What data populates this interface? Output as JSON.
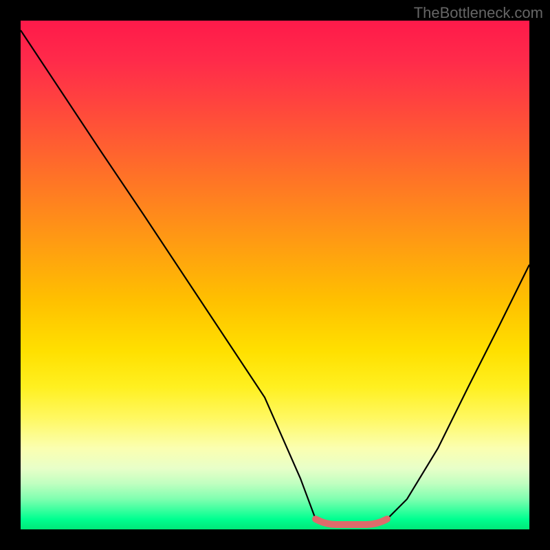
{
  "watermark": "TheBottleneck.com",
  "chart_data": {
    "type": "line",
    "title": "",
    "xlabel": "",
    "ylabel": "",
    "xlim": [
      0,
      100
    ],
    "ylim": [
      0,
      100
    ],
    "background": "red-yellow-green vertical gradient (red top, green bottom)",
    "series": [
      {
        "name": "bottleneck-curve",
        "color": "#000000",
        "x": [
          0,
          8,
          16,
          24,
          32,
          40,
          48,
          55,
          58,
          62,
          68,
          72,
          76,
          82,
          88,
          94,
          100
        ],
        "values": [
          98,
          86,
          74,
          62,
          50,
          38,
          26,
          10,
          2,
          1,
          1,
          2,
          6,
          16,
          28,
          40,
          52
        ]
      },
      {
        "name": "optimal-range-marker",
        "color": "#e07070",
        "x": [
          58,
          62,
          68,
          72
        ],
        "values": [
          2,
          1,
          1,
          2
        ]
      }
    ],
    "gradient_stops": [
      {
        "pos": 0,
        "color": "#ff1a4a"
      },
      {
        "pos": 15,
        "color": "#ff4040"
      },
      {
        "pos": 35,
        "color": "#ff8020"
      },
      {
        "pos": 55,
        "color": "#ffc000"
      },
      {
        "pos": 72,
        "color": "#fff020"
      },
      {
        "pos": 88,
        "color": "#e8ffc8"
      },
      {
        "pos": 100,
        "color": "#00e878"
      }
    ]
  }
}
